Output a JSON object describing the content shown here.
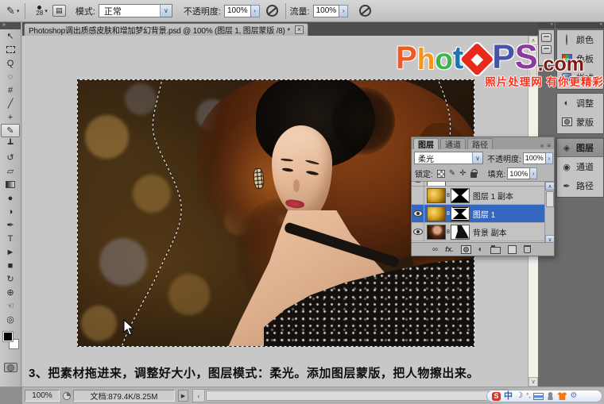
{
  "app": {
    "selection_blue": "#3468c0",
    "dock_dark": "#6b6b6b"
  },
  "options_bar": {
    "tool_icon_glyph": "✎",
    "preset_caret": "▾",
    "brush_size": "28",
    "size_caret": "▾",
    "toggle_glyph": "▤",
    "mode_label": "模式:",
    "mode_value": "正常",
    "dropdown_caret": "∨",
    "opacity_label": "不透明度:",
    "opacity_value": "100%",
    "stepper_glyph": "›",
    "flow_label": "流量:",
    "flow_value": "100%"
  },
  "document_tab": {
    "title": "Photoshop调出质感皮肤和增加梦幻背景.psd @ 100% (图层 1, 图层蒙版 /8) *",
    "close_glyph": "×"
  },
  "toolbox": {
    "collapse_glyph": "»",
    "foreground_color": "#000000",
    "background_color": "#ffffff",
    "tools": [
      {
        "name": "move",
        "glyph": "↖"
      },
      {
        "name": "marquee",
        "glyph": ""
      },
      {
        "name": "lasso",
        "glyph": "Q"
      },
      {
        "name": "quick-selection",
        "glyph": "◌"
      },
      {
        "name": "crop",
        "glyph": "#"
      },
      {
        "name": "eyedropper",
        "glyph": "╱"
      },
      {
        "name": "spot-healing",
        "glyph": "+"
      },
      {
        "name": "brush",
        "glyph": "✎"
      },
      {
        "name": "clone-stamp",
        "glyph": "┻"
      },
      {
        "name": "history-brush",
        "glyph": "↺"
      },
      {
        "name": "eraser",
        "glyph": "▱"
      },
      {
        "name": "gradient",
        "glyph": ""
      },
      {
        "name": "blur",
        "glyph": "●"
      },
      {
        "name": "dodge",
        "glyph": "◑"
      },
      {
        "name": "pen",
        "glyph": "✒"
      },
      {
        "name": "type",
        "glyph": "T"
      },
      {
        "name": "path-selection",
        "glyph": "►"
      },
      {
        "name": "shape",
        "glyph": "■"
      },
      {
        "name": "rotate-3d",
        "glyph": "↻"
      },
      {
        "name": "orbit-3d",
        "glyph": "⊕"
      },
      {
        "name": "hand",
        "glyph": "☜"
      },
      {
        "name": "zoom",
        "glyph": "◎"
      }
    ]
  },
  "layers_panel": {
    "tabs": [
      "图层",
      "通道",
      "路径"
    ],
    "panel_arrows": "»",
    "panel_menu": "≡",
    "blend_mode": "柔光",
    "dropdown_caret": "∨",
    "opacity_label": "不透明度:",
    "opacity_value": "100%",
    "stepper_glyph": "›",
    "lock_label": "锁定:",
    "lock_brush_glyph": "✎",
    "lock_move_glyph": "✛",
    "fill_label": "填充:",
    "fill_value": "100%",
    "link_badge": "8",
    "layers": [
      {
        "name": "图层 1 副本"
      },
      {
        "name": "图层 1"
      },
      {
        "name": "背景 副本"
      }
    ],
    "link_glyph": "∞",
    "fx_label": "fx.",
    "adjust_glyph": "◐",
    "scroll_up": "∧",
    "scroll_down": "∨"
  },
  "right_dock": {
    "collapse_glyph": "«",
    "adjust_glyph": "◐",
    "layers_glyph": "◈",
    "channels_glyph": "◉",
    "paths_glyph": "✒",
    "buttons": [
      {
        "label": "颜色"
      },
      {
        "label": "色板"
      },
      {
        "label": "样式"
      },
      {
        "label": "调整"
      },
      {
        "label": "蒙版"
      },
      {
        "label": "图层"
      },
      {
        "label": "通道"
      },
      {
        "label": "路径"
      }
    ]
  },
  "watermark": {
    "letters": [
      {
        "ch": "P",
        "style": "color:#f15a22;font-size:40px"
      },
      {
        "ch": "h",
        "style": "color:#f7941d;font-size:37px"
      },
      {
        "ch": "o",
        "style": "color:#3bb54a;font-size:37px"
      },
      {
        "ch": "t",
        "style": "color:#1b75bc;font-size:40px"
      },
      {
        "ch": "P",
        "style": "color:#4656a6;font-size:43px"
      },
      {
        "ch": "S",
        "style": "color:#8b3a9e;font-size:43px"
      }
    ],
    "diamond_color": "#e8291c",
    "dot_com": ".com",
    "dot_com_style": "color:#801a15;font-size:25px;transform:translateY(2px)",
    "tagline": "照片处理网 有你更精彩",
    "tagline_color": "#ff2d16"
  },
  "caption": "3、把素材拖进来，调整好大小，图层模式：柔光。添加图层蒙版，把人物擦出来。",
  "status_bar": {
    "zoom_value": "100%",
    "doc_info": "文档:879.4K/8.25M",
    "arrow_glyph": "▶",
    "hscroll_left": "‹",
    "hscroll_right": "›",
    "vscroll_up": "∧",
    "vscroll_down": "∨"
  },
  "ime_bar": {
    "logo_text": "S",
    "mode_text": "中",
    "moon_glyph": "☽",
    "punct_text": "°,"
  }
}
